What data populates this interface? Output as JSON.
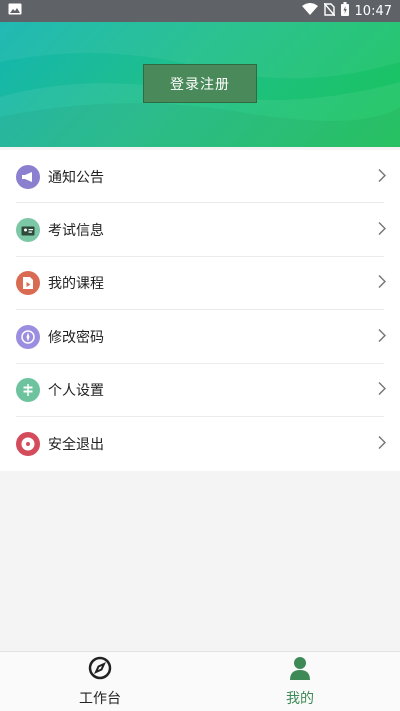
{
  "status_bar": {
    "time": "10:47"
  },
  "header": {
    "login_label": "登录注册"
  },
  "menu": {
    "items": [
      {
        "label": "通知公告",
        "icon": "megaphone-icon",
        "color": "#8b7fd0"
      },
      {
        "label": "考试信息",
        "icon": "exam-id-icon",
        "color": "#7cc7a6"
      },
      {
        "label": "我的课程",
        "icon": "course-document-icon",
        "color": "#d96b53"
      },
      {
        "label": "修改密码",
        "icon": "compass-icon",
        "color": "#9b8ee0"
      },
      {
        "label": "个人设置",
        "icon": "signpost-icon",
        "color": "#6cc39e"
      },
      {
        "label": "安全退出",
        "icon": "power-target-icon",
        "color": "#d44c5b"
      }
    ]
  },
  "tabbar": {
    "tabs": [
      {
        "label": "工作台",
        "icon": "compass-icon",
        "active": false
      },
      {
        "label": "我的",
        "icon": "user-icon",
        "active": true
      }
    ]
  },
  "colors": {
    "accent": "#3e8a56",
    "header_start": "#14b5b0",
    "header_end": "#19c45a"
  }
}
